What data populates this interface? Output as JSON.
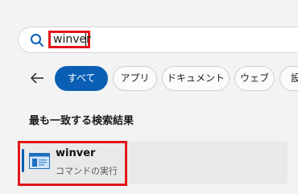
{
  "search": {
    "value": "winver",
    "icon": "search-icon"
  },
  "nav": {
    "back_icon": "back-arrow-icon"
  },
  "filters": [
    {
      "label": "すべて",
      "active": true
    },
    {
      "label": "アプリ",
      "active": false
    },
    {
      "label": "ドキュメント",
      "active": false
    },
    {
      "label": "ウェブ",
      "active": false
    },
    {
      "label": "設",
      "active": false
    }
  ],
  "results": {
    "section_title": "最も一致する検索結果",
    "best_match": {
      "title": "winver",
      "subtitle": "コマンドの実行",
      "icon": "app-window-icon"
    }
  },
  "colors": {
    "accent": "#0a5fb4",
    "highlight_box": "#e3151a",
    "background": "#f3f3f3"
  }
}
